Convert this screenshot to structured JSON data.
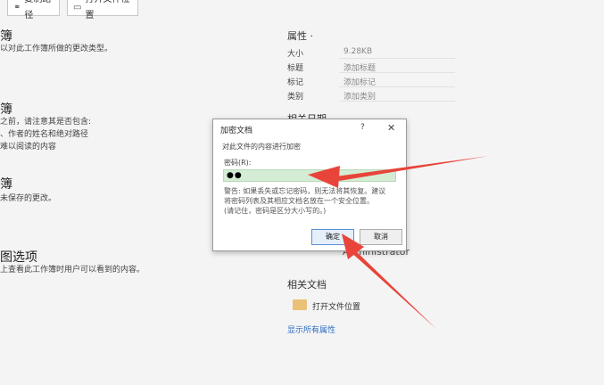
{
  "toolbar": {
    "copy_path": "复制路径",
    "open_location": "打开文件位置"
  },
  "left": {
    "sections": [
      {
        "heading": "簿",
        "lines": [
          "以对此工作簿所做的更改类型。"
        ]
      },
      {
        "heading": "簿",
        "lines": [
          "之前，请注意其是否包含:",
          "、作者的姓名和绝对路径",
          "难以阅读的内容"
        ]
      },
      {
        "heading": "簿",
        "lines": [
          "未保存的更改。"
        ]
      },
      {
        "heading": "图选项",
        "lines": [
          "上查看此工作簿时用户可以看到的内容。"
        ]
      }
    ]
  },
  "properties": {
    "title": "属性 ·",
    "rows": [
      {
        "label": "大小",
        "value": "9.28KB"
      },
      {
        "label": "标题",
        "value": "添加标题"
      },
      {
        "label": "标记",
        "value": "添加标记"
      },
      {
        "label": "类别",
        "value": "添加类别"
      }
    ],
    "related_dates_partial": "相关日期"
  },
  "dialog": {
    "title": "加密文档",
    "help": "?",
    "close": "✕",
    "message": "对此文件的内容进行加密",
    "password_label": "密码(R):",
    "password_value": "●●",
    "warning_lines": [
      "警告: 如果丢失或忘记密码，则无法将其恢复。建议",
      "将密码列表及其相应文档名放在一个安全位置。",
      "(请记住，密码是区分大小写的。)"
    ],
    "ok": "确定",
    "cancel": "取消"
  },
  "related_people": {
    "name": "Administrator"
  },
  "related_docs": {
    "title": "相关文档",
    "open_location": "打开文件位置",
    "show_all": "显示所有属性"
  },
  "annotation": {
    "arrow_color": "#e8443a"
  }
}
